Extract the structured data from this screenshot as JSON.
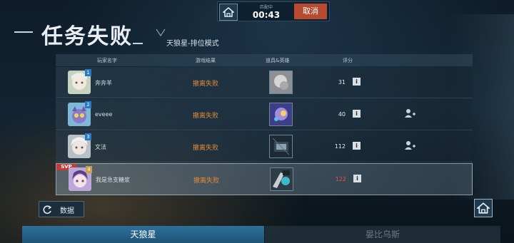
{
  "match": {
    "timer_label": "匹配中",
    "timer": "00:43",
    "cancel_label": "取消"
  },
  "title": "任务失败",
  "mode": "天狼星-排位模式",
  "table": {
    "headers": [
      "玩家名字",
      "游戏结果",
      "道具&英雄",
      "评分"
    ],
    "rows": [
      {
        "rank": "1",
        "name": "奔奔羊",
        "result": "撤离失败",
        "score": "31",
        "svp": "",
        "add_friend": false,
        "self": false
      },
      {
        "rank": "2",
        "name": "eveee",
        "result": "撤离失败",
        "score": "40",
        "svp": "",
        "add_friend": true,
        "self": false
      },
      {
        "rank": "3",
        "name": "文法",
        "result": "撤离失败",
        "score": "112",
        "svp": "",
        "add_friend": true,
        "self": false
      },
      {
        "rank": "4",
        "name": "我是急支糖浆",
        "result": "撤离失败",
        "score": "122",
        "svp": "SVP",
        "add_friend": false,
        "self": true
      }
    ]
  },
  "info_glyph": "i",
  "data_button": "数据",
  "tabs": [
    "天狼星",
    "晏比乌斯"
  ],
  "colors": {
    "result_fail": "#e08a3a",
    "cancel": "#b84a30",
    "active_tab": "#2d6f99",
    "svp": "#c43a3a"
  },
  "icons": {
    "home": "home-icon",
    "info": "info-icon",
    "add_friend": "add-friend-icon",
    "refresh": "refresh-icon"
  }
}
